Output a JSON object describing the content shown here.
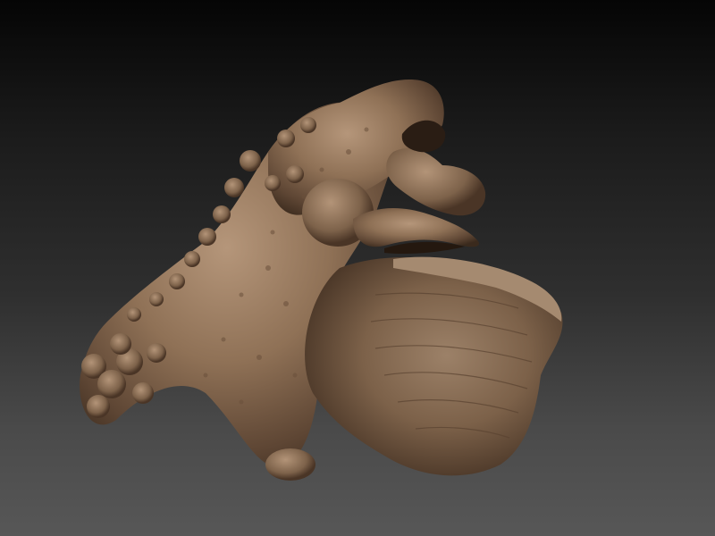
{
  "viewport": {
    "background_top": "#050505",
    "background_bottom": "#575757",
    "model_base_color": "#8a6c52",
    "model_shadow_color": "#3a2a1d",
    "model_highlight_color": "#b5967a"
  },
  "model": {
    "subject": "sculpted-creature-head"
  }
}
